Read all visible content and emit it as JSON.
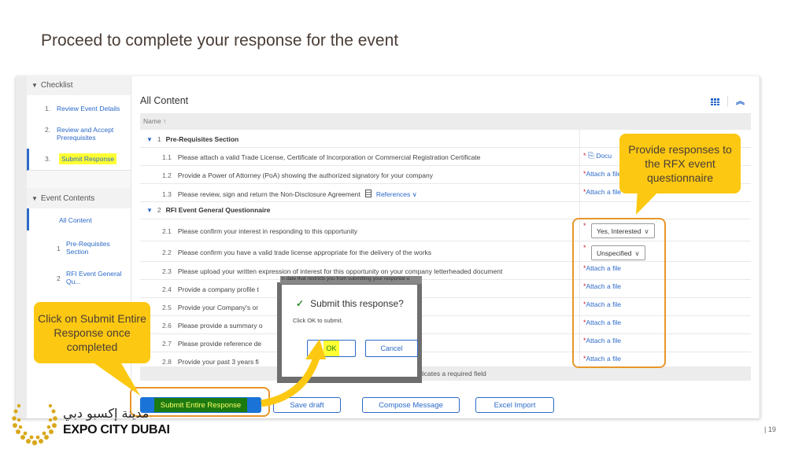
{
  "slide": {
    "title": "Proceed to complete your response for the event",
    "page_number": "| 19",
    "logo_arabic": "مدينة إكسبو دبي",
    "logo_text": "EXPO CITY DUBAI"
  },
  "sidebar": {
    "checklist_header": "Checklist",
    "checklist": [
      {
        "num": "1.",
        "label": "Review Event Details"
      },
      {
        "num": "2.",
        "label": "Review and Accept Prerequisites"
      },
      {
        "num": "3.",
        "label": "Submit Response",
        "highlighted": true
      }
    ],
    "contents_header": "Event Contents",
    "contents": [
      {
        "num": "",
        "label": "All Content",
        "active": true
      },
      {
        "num": "1",
        "label": "Pre-Requisites Section"
      },
      {
        "num": "2",
        "label": "RFI Event General Qu..."
      }
    ]
  },
  "main": {
    "title": "All Content",
    "column_header": "Name ↑",
    "sections": [
      {
        "num": "1",
        "label": "Pre-Requisites Section",
        "items": [
          {
            "num": "1.1",
            "text": "Please attach a valid Trade License, Certificate of Incorporation or Commercial Registration Certificate",
            "response": "Docu",
            "type": "document"
          },
          {
            "num": "1.2",
            "text": "Provide a Power of Attorney (PoA) showing the authorized signatory for your company",
            "response": "Attach a file",
            "type": "file"
          },
          {
            "num": "1.3",
            "text": "Please review, sign and return the Non-Disclosure Agreement",
            "references": "References",
            "response": "Attach a file",
            "type": "file"
          }
        ]
      },
      {
        "num": "2",
        "label": "RFI Event General Questionnaire",
        "items": [
          {
            "num": "2.1",
            "text": "Please confirm your interest in responding to this opportunity",
            "response": "Yes, Interested",
            "type": "select"
          },
          {
            "num": "2.2",
            "text": "Please confirm you have a valid trade license appropriate for the delivery of the works",
            "response": "Unspecified",
            "type": "select"
          },
          {
            "num": "2.3",
            "text": "Please upload your written expression of interest for this opportunity on your company letterheaded document",
            "response": "Attach a file",
            "type": "file"
          },
          {
            "num": "2.4",
            "text": "Provide a company profile t",
            "response": "Attach a file",
            "type": "file"
          },
          {
            "num": "2.5",
            "text": "Provide your Company's or",
            "response": "Attach a file",
            "type": "file"
          },
          {
            "num": "2.6",
            "text": "Please provide a summary o",
            "response": "Attach a file",
            "type": "file"
          },
          {
            "num": "2.7",
            "text": "Please provide reference de",
            "response": "Attach a file",
            "type": "file"
          },
          {
            "num": "2.8",
            "text": "Provide your past 3 years fi",
            "response": "Attach a file",
            "type": "file"
          }
        ]
      }
    ],
    "required_note": "(*) indicates a required field",
    "required_marker": "*"
  },
  "buttons": {
    "submit": "Submit Entire Response",
    "save_draft": "Save draft",
    "compose": "Compose Message",
    "excel": "Excel Import"
  },
  "dialog": {
    "strip_text": "n date that restricts you from submitting your response u",
    "title": "Submit this response?",
    "message": "Click OK to submit.",
    "ok": "OK",
    "cancel": "Cancel"
  },
  "callouts": {
    "responses": "Provide responses to the RFX event questionnaire",
    "submit": "Click on Submit Entire Response once completed"
  },
  "colors": {
    "accent": "#2c6ac9",
    "callout": "#fcc812",
    "highlight_box": "#e8962a",
    "required": "#c8283a"
  }
}
